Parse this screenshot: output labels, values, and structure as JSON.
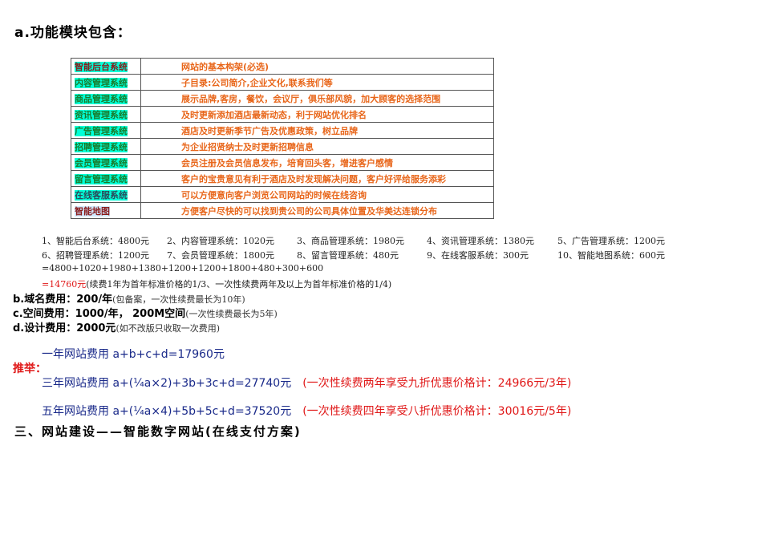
{
  "heading": "a.功能模块包含：",
  "modules": [
    {
      "name": "智能后台系统",
      "desc": "网站的基本构架(必选)"
    },
    {
      "name": "内容管理系统",
      "desc": "子目录:公司简介,企业文化,联系我们等"
    },
    {
      "name": "商品管理系统",
      "desc": "展示品牌,客房，餐饮，会议厅，俱乐部风貌，加大顾客的选择范围"
    },
    {
      "name": "资讯管理系统",
      "desc": "及时更新添加酒店最新动态，利于网站优化排名"
    },
    {
      "name": "广告管理系统",
      "desc": "酒店及时更新季节广告及优惠政策，树立品牌"
    },
    {
      "name": "招聘管理系统",
      "desc": "为企业招贤纳士及时更新招聘信息"
    },
    {
      "name": "会员管理系统",
      "desc": "会员注册及会员信息发布，培育回头客，增进客户感情"
    },
    {
      "name": "留言管理系统",
      "desc": "客户的宝贵意见有利于酒店及时发现解决问题，客户好评给服务添彩"
    },
    {
      "name": "在线客服系统",
      "desc": "可以方便意向客户浏览公司网站的时候在线咨询"
    },
    {
      "name": "智能地图",
      "desc": "方便客户尽快的可以找到贵公司的公司具体位置及华美达连锁分布"
    }
  ],
  "prices": [
    "1、智能后台系统：4800元",
    "2、内容管理系统：1020元",
    "3、商品管理系统：1980元",
    "4、资讯管理系统：1380元",
    "5、广告管理系统：1200元",
    "6、招聘管理系统：1200元",
    "7、会员管理系统：1800元",
    "8、留言管理系统：480元",
    "9、在线客服系统：300元",
    "10、智能地图系统：600元"
  ],
  "sum_formula": "=4800+1020+1980+1380+1200+1200+1800+480+300+600",
  "sum_total": "=14760元",
  "sum_note": "(续费1年为首年标准价格的1/3、一次性续费两年及以上为首年标准价格的1/4)",
  "b": {
    "label": "b.域名费用：200/年",
    "note": "(包备案，一次性续费最长为10年)"
  },
  "c": {
    "label": "c.空间费用：1000/年， 200M空间",
    "note": "(一次性续费最长为5年)"
  },
  "d": {
    "label": "d.设计费用：2000元",
    "note": "(如不改版只收取一次费用)"
  },
  "one_year": "一年网站费用 a+b+c+d=17960元",
  "recommend": "推举：",
  "three_year": "三年网站费用 a+(¼a×2)+3b+3c+d=27740元",
  "three_year_offer": "(一次性续费两年享受九折优惠价格计：24966元/3年)",
  "five_year": "五年网站费用 a+(¼a×4)+5b+5c+d=37520元",
  "five_year_offer": "(一次性续费四年享受八折优惠价格计：30016元/5年)",
  "section3": "三、网站建设——智能数字网站(在线支付方案)"
}
